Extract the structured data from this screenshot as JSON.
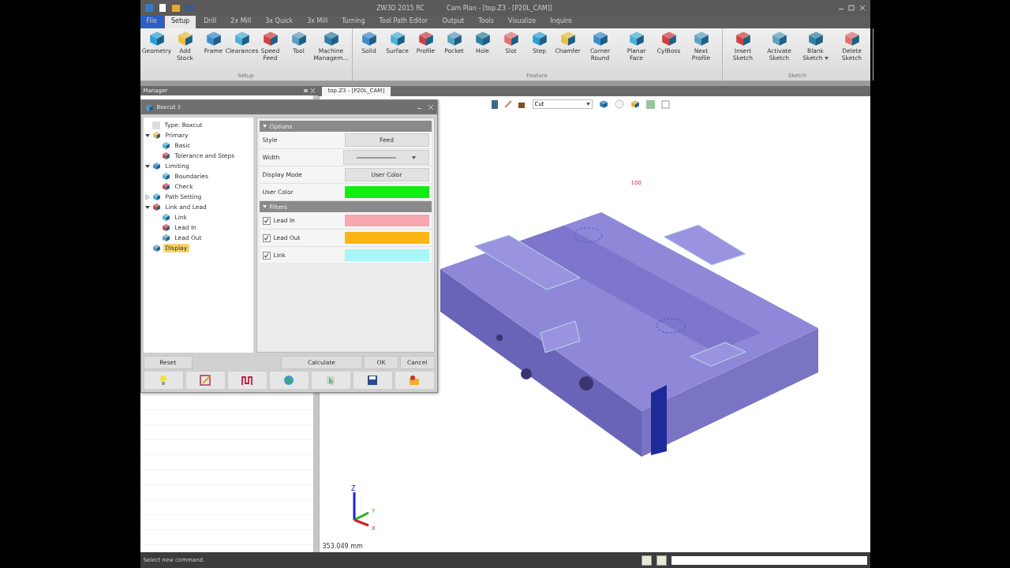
{
  "title_bar": {
    "app": "ZW3D 2015 RC",
    "document": "Cam Plan - [top.Z3 - [P20L_CAM]]"
  },
  "menu_tabs": [
    {
      "label": "File",
      "kind": "file",
      "selected": false
    },
    {
      "label": "Setup",
      "kind": "tab",
      "selected": true
    },
    {
      "label": "Drill",
      "kind": "tab",
      "selected": false
    },
    {
      "label": "2x Mill",
      "kind": "tab",
      "selected": false
    },
    {
      "label": "3x Quick",
      "kind": "tab",
      "selected": false
    },
    {
      "label": "3x Mill",
      "kind": "tab",
      "selected": false
    },
    {
      "label": "Turning",
      "kind": "tab",
      "selected": false
    },
    {
      "label": "Tool Path Editor",
      "kind": "tab",
      "selected": false
    },
    {
      "label": "Output",
      "kind": "tab",
      "selected": false
    },
    {
      "label": "Tools",
      "kind": "tab",
      "selected": false
    },
    {
      "label": "Visualize",
      "kind": "tab",
      "selected": false
    },
    {
      "label": "Inquire",
      "kind": "tab",
      "selected": false
    }
  ],
  "ribbon_groups": [
    {
      "label": "Setup",
      "items": [
        {
          "label": "Geometry"
        },
        {
          "label": "Add Stock"
        },
        {
          "label": "Frame"
        },
        {
          "label": "Clearances"
        },
        {
          "label": "Speed Feed"
        },
        {
          "label": "Tool"
        },
        {
          "label": "Machine Managem..."
        }
      ]
    },
    {
      "label": "Feature",
      "items": [
        {
          "label": "Solid"
        },
        {
          "label": "Surface"
        },
        {
          "label": "Profile"
        },
        {
          "label": "Pocket"
        },
        {
          "label": "Hole"
        },
        {
          "label": "Slot"
        },
        {
          "label": "Step"
        },
        {
          "label": "Chamfer"
        },
        {
          "label": "Corner Round"
        },
        {
          "label": "Planar Face"
        },
        {
          "label": "CylBoss"
        },
        {
          "label": "Next Profile"
        }
      ]
    },
    {
      "label": "Sketch",
      "items": [
        {
          "label": "Insert Sketch"
        },
        {
          "label": "Activate Sketch"
        },
        {
          "label": "Blank Sketch",
          "dropdown": true
        },
        {
          "label": "Delete Sketch"
        }
      ]
    }
  ],
  "manager": {
    "title": "Manager"
  },
  "document_tab": {
    "label": "top.Z3 - [P20L_CAM]"
  },
  "dialog": {
    "title": "Boxcut 1",
    "tree": [
      {
        "label": "Type: Boxcut",
        "selected": false
      },
      {
        "label": "Primary",
        "expanded": true,
        "selected": false,
        "children": [
          {
            "label": "Basic",
            "selected": false
          },
          {
            "label": "Tolerance and Steps",
            "selected": false
          }
        ]
      },
      {
        "label": "Limiting",
        "expanded": true,
        "selected": false,
        "children": [
          {
            "label": "Boundaries",
            "selected": false
          },
          {
            "label": "Check",
            "selected": false
          }
        ]
      },
      {
        "label": "Path Setting",
        "expanded": false,
        "selected": false
      },
      {
        "label": "Link and Lead",
        "expanded": true,
        "selected": false,
        "children": [
          {
            "label": "Link",
            "selected": false
          },
          {
            "label": "Lead In",
            "selected": false
          },
          {
            "label": "Lead Out",
            "selected": false
          }
        ]
      },
      {
        "label": "Display",
        "selected": true
      }
    ],
    "sections": [
      {
        "title": "Options",
        "rows": [
          {
            "label": "Style",
            "kind": "button",
            "value": "Feed"
          },
          {
            "label": "Width",
            "kind": "line-dropdown"
          },
          {
            "label": "Display Mode",
            "kind": "button",
            "value": "User Color"
          },
          {
            "label": "User Color",
            "kind": "swatch",
            "color": "#11ee11"
          }
        ]
      },
      {
        "title": "Filters",
        "rows": [
          {
            "label": "Lead In",
            "kind": "check",
            "checked": true,
            "color": "#f7a7ae"
          },
          {
            "label": "Lead Out",
            "kind": "check",
            "checked": true,
            "color": "#fbb514"
          },
          {
            "label": "Link",
            "kind": "check",
            "checked": true,
            "color": "#a8f7f7"
          }
        ]
      }
    ],
    "buttons": [
      "Reset",
      "Calculate",
      "OK",
      "Cancel"
    ]
  },
  "viewport": {
    "filter": "Cut",
    "dimension": "100",
    "axes": [
      "Z",
      "Y",
      "X"
    ],
    "scale": "353.049 mm"
  },
  "status_bar": {
    "message": "Select new command."
  }
}
